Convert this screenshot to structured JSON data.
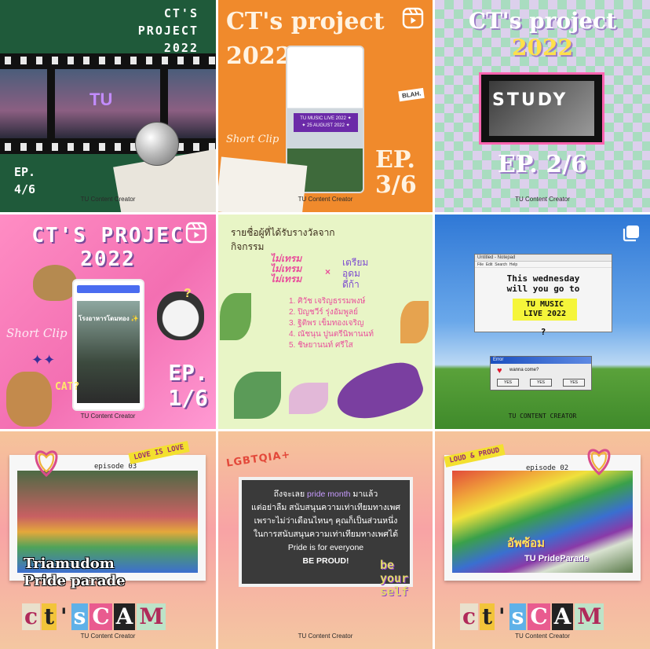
{
  "credit": "TU Content Creator",
  "tiles": [
    {
      "title": "CT'S\nPROJECT\n2022",
      "episode": "EP.\n4/6",
      "frame_text": "TU",
      "icon": "none"
    },
    {
      "title": "CT's project\n2022",
      "episode": "EP.\n3/6",
      "short_clip": "Short Clip",
      "blah": "BLAH.",
      "phone_banner": "TU MUSIC LIVE 2022 ✦\n✦ 25 AUGUST 2022 ✦",
      "icon": "reels-icon"
    },
    {
      "title": "CT's project\n",
      "year": "2022",
      "study": "STUDY",
      "episode": "EP. 2/6",
      "icon": "none"
    },
    {
      "title": "CT'S PROJEC\n2022",
      "episode": "EP.\n1/6",
      "short_clip": "Short Clip",
      "cat": "CAT?",
      "phone_text": "โรงอาหารโดมทอง ✨",
      "icon": "reels-icon"
    },
    {
      "heading": "รายชื่อผู้ที่ได้รับรางวัลจาก\nกิจกรรม",
      "tag_left": "ไม่เทรม\nไม่เทรม\nไม่เทรม",
      "tag_x": "×",
      "tag_right": "เตรียม\nอุดม\nดีก้า",
      "winners": [
        "1. ศิวัช เจริญธรรมพงษ์",
        "2. ปิญชวีร์ รุ่งอัมพูลย์",
        "3. ฐิติพร เข็มทองเจริญ",
        "4. ณัชนุน ปูนตรีนิพานนท์",
        "5. ชิษยานนท์ ศรีใส"
      ],
      "icon": "none"
    },
    {
      "notepad_title": "Untitled - Notepad",
      "notepad_menu": "File  Edit  Search  Help",
      "question_text": "This wednesday\nwill you go to",
      "highlight": "TU MUSIC\nLIVE 2022",
      "qmark": "?",
      "error_title": "Error",
      "error_msg": "wanna come?",
      "buttons": [
        "YES",
        "YES",
        "YES"
      ],
      "credit": "TU CONTENT CREATOR",
      "icon": "multi-photo-icon"
    },
    {
      "episode": "episode 03",
      "tag": "LOVE IS LOVE",
      "photo_text": "Triamudom\nPride parade",
      "cam_letters": [
        "c",
        "t",
        "'",
        "s",
        "C",
        "A",
        "M"
      ],
      "icon": "none"
    },
    {
      "sticker": "LGBTQIA+",
      "line1": "ถึงจะเลย ",
      "pride_month": "pride month",
      "line1_end": " มาแล้ว",
      "line2": "แต่อย่าลืม สนับสนุนความเท่าเทียมทางเพศ",
      "line3": "เพราะไม่ว่าเดือนไหนๆ คุณก็เป็นส่วนหนึ่ง",
      "line4": "ในการสนับสนุนความเท่าเทียมทางเพศได้",
      "line5": "Pride is for everyone",
      "line6": "BE PROUD!",
      "be_yourself": "be\nyour\nself",
      "icon": "none"
    },
    {
      "episode": "episode 02",
      "tag": "LOUD & PROUD",
      "photo_text": "อัพซ้อม",
      "photo_text2": "TU PrideParade",
      "cam_letters": [
        "c",
        "t",
        "'",
        "s",
        "C",
        "A",
        "M"
      ],
      "icon": "none"
    }
  ]
}
